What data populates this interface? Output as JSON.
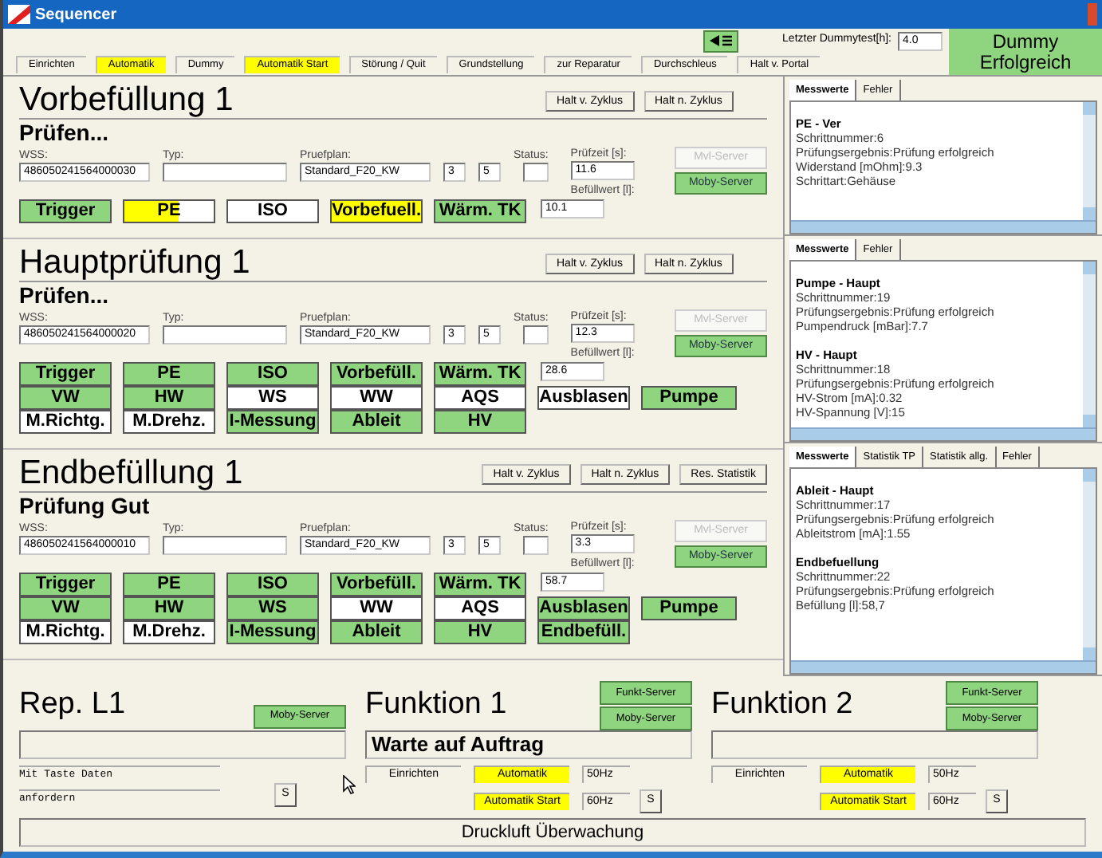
{
  "window": {
    "title": "Sequencer"
  },
  "toolbar": {
    "modes": [
      {
        "label": "Einrichten",
        "selected": false
      },
      {
        "label": "Automatik",
        "selected": true
      },
      {
        "label": "Dummy",
        "selected": false
      },
      {
        "label": "Automatik Start",
        "selected": true
      },
      {
        "label": "Störung / Quit",
        "selected": false
      },
      {
        "label": "Grundstellung",
        "selected": false
      },
      {
        "label": "zur Reparatur",
        "selected": false
      },
      {
        "label": "Durchschleus",
        "selected": false
      },
      {
        "label": "Halt v. Portal",
        "selected": false
      }
    ],
    "dummy_label": "Letzter Dummytest[h]:",
    "dummy_value": "4.0",
    "dummy_status": "Dummy Erfolgreich"
  },
  "stations": [
    {
      "title": "Vorbefüllung 1",
      "status": "Prüfen...",
      "halt_buttons": [
        "Halt v. Zyklus",
        "Halt n. Zyklus"
      ],
      "fields": {
        "wss_label": "WSS:",
        "wss": "486050241564000030",
        "typ_label": "Typ:",
        "pruefplan_label": "Pruefplan:",
        "pruefplan": "Standard_F20_KW",
        "num_1": "3",
        "num_2": "5",
        "status_label": "Status:",
        "pruefzeit_label": "Prüfzeit [s]:",
        "pruefzeit": "11.6",
        "befuellwert_label": "Befüllwert [l]:",
        "befuellwert": "10.1"
      },
      "servers": [
        {
          "label": "Mvl-Server",
          "disabled": true
        },
        {
          "label": "Moby-Server",
          "disabled": false
        }
      ],
      "indicators": [
        [
          {
            "label": "Trigger",
            "color": "#8fd47e"
          },
          {
            "label": "PE",
            "color": "#ffff00",
            "level": 0.6
          },
          {
            "label": "ISO",
            "color": "#ffffff"
          },
          {
            "label": "Vorbefuell.",
            "color": "#ffff00"
          },
          {
            "label": "Wärm. TK",
            "color": "#8fd47e"
          }
        ]
      ]
    },
    {
      "title": "Hauptprüfung 1",
      "status": "Prüfen...",
      "halt_buttons": [
        "Halt v. Zyklus",
        "Halt n. Zyklus"
      ],
      "fields": {
        "wss_label": "WSS:",
        "wss": "486050241564000020",
        "typ_label": "Typ:",
        "pruefplan_label": "Pruefplan:",
        "pruefplan": "Standard_F20_KW",
        "num_1": "3",
        "num_2": "5",
        "status_label": "Status:",
        "pruefzeit_label": "Prüfzeit [s]:",
        "pruefzeit": "12.3",
        "befuellwert_label": "Befüllwert [l]:",
        "befuellwert": "28.6"
      },
      "servers": [
        {
          "label": "Mvl-Server",
          "disabled": true
        },
        {
          "label": "Moby-Server",
          "disabled": false
        }
      ],
      "indicators": [
        [
          {
            "label": "Trigger",
            "color": "#8fd47e"
          },
          {
            "label": "PE",
            "color": "#8fd47e"
          },
          {
            "label": "ISO",
            "color": "#8fd47e"
          },
          {
            "label": "Vorbefüll.",
            "color": "#8fd47e"
          },
          {
            "label": "Wärm. TK",
            "color": "#8fd47e"
          }
        ],
        [
          {
            "label": "VW",
            "color": "#8fd47e"
          },
          {
            "label": "HW",
            "color": "#8fd47e"
          },
          {
            "label": "WS",
            "color": "#ffffff"
          },
          {
            "label": "WW",
            "color": "#ffffff"
          },
          {
            "label": "AQS",
            "color": "#ffffff"
          },
          {
            "label": "Ausblasen",
            "color": "#ffffff"
          },
          {
            "label": "Pumpe",
            "color": "#8fd47e"
          }
        ],
        [
          {
            "label": "M.Richtg.",
            "color": "#ffffff"
          },
          {
            "label": "M.Drehz.",
            "color": "#ffffff"
          },
          {
            "label": "I-Messung",
            "color": "#8fd47e"
          },
          {
            "label": "Ableit",
            "color": "#8fd47e"
          },
          {
            "label": "HV",
            "color": "#8fd47e"
          }
        ]
      ]
    },
    {
      "title": "Endbefüllung 1",
      "status": "Prüfung Gut",
      "halt_buttons": [
        "Halt v. Zyklus",
        "Halt n. Zyklus",
        "Res. Statistik"
      ],
      "fields": {
        "wss_label": "WSS:",
        "wss": "486050241564000010",
        "typ_label": "Typ:",
        "pruefplan_label": "Pruefplan:",
        "pruefplan": "Standard_F20_KW",
        "num_1": "3",
        "num_2": "5",
        "status_label": "Status:",
        "pruefzeit_label": "Prüfzeit [s]:",
        "pruefzeit": "3.3",
        "befuellwert_label": "Befüllwert [l]:",
        "befuellwert": "58.7"
      },
      "servers": [
        {
          "label": "Mvl-Server",
          "disabled": true
        },
        {
          "label": "Moby-Server",
          "disabled": false
        }
      ],
      "indicators": [
        [
          {
            "label": "Trigger",
            "color": "#8fd47e"
          },
          {
            "label": "PE",
            "color": "#8fd47e"
          },
          {
            "label": "ISO",
            "color": "#8fd47e"
          },
          {
            "label": "Vorbefüll.",
            "color": "#8fd47e"
          },
          {
            "label": "Wärm. TK",
            "color": "#8fd47e"
          }
        ],
        [
          {
            "label": "VW",
            "color": "#8fd47e"
          },
          {
            "label": "HW",
            "color": "#8fd47e"
          },
          {
            "label": "WS",
            "color": "#8fd47e"
          },
          {
            "label": "WW",
            "color": "#ffffff"
          },
          {
            "label": "AQS",
            "color": "#ffffff"
          },
          {
            "label": "Ausblasen",
            "color": "#8fd47e"
          },
          {
            "label": "Pumpe",
            "color": "#8fd47e"
          }
        ],
        [
          {
            "label": "M.Richtg.",
            "color": "#ffffff"
          },
          {
            "label": "M.Drehz.",
            "color": "#ffffff"
          },
          {
            "label": "I-Messung",
            "color": "#8fd47e"
          },
          {
            "label": "Ableit",
            "color": "#8fd47e"
          },
          {
            "label": "HV",
            "color": "#8fd47e"
          },
          {
            "label": "Endbefüll.",
            "color": "#8fd47e"
          }
        ]
      ]
    }
  ],
  "panels": [
    {
      "tabs": [
        {
          "label": "Messwerte",
          "selected": true
        },
        {
          "label": "Fehler",
          "selected": false
        }
      ],
      "entries": [
        {
          "title": "PE - Ver",
          "lines": [
            "Schrittnummer:6",
            "Prüfungsergebnis:Prüfung erfolgreich",
            "Widerstand [mOhm]:9.3",
            "Schrittart:Gehäuse"
          ]
        }
      ]
    },
    {
      "tabs": [
        {
          "label": "Messwerte",
          "selected": true
        },
        {
          "label": "Fehler",
          "selected": false
        }
      ],
      "entries": [
        {
          "title": "Pumpe - Haupt",
          "lines": [
            "Schrittnummer:19",
            "Prüfungsergebnis:Prüfung erfolgreich",
            "Pumpendruck [mBar]:7.7"
          ]
        },
        {
          "title": "HV - Haupt",
          "lines": [
            "Schrittnummer:18",
            "Prüfungsergebnis:Prüfung erfolgreich",
            "HV-Strom [mA]:0.32",
            "HV-Spannung [V]:15"
          ]
        }
      ]
    },
    {
      "tabs": [
        {
          "label": "Messwerte",
          "selected": true
        },
        {
          "label": "Statistik TP",
          "selected": false
        },
        {
          "label": "Statistik allg.",
          "selected": false
        },
        {
          "label": "Fehler",
          "selected": false
        }
      ],
      "entries": [
        {
          "title": "Ableit - Haupt",
          "lines": [
            "Schrittnummer:17",
            "Prüfungsergebnis:Prüfung erfolgreich",
            "Ableitstrom [mA]:1.55"
          ]
        },
        {
          "title": "Endbefuellung",
          "lines": [
            "Schrittnummer:22",
            "Prüfungsergebnis:Prüfung erfolgreich",
            "Befüllung [l]:58,7"
          ]
        }
      ]
    }
  ],
  "repair": {
    "title": "Rep. L1",
    "server": "Moby-Server",
    "message_lines": [
      "Mit Taste Daten",
      "anfordern"
    ],
    "s_button": "S"
  },
  "functions": [
    {
      "title": "Funktion 1",
      "servers": [
        "Funkt-Server",
        "Moby-Server"
      ],
      "status": "Warte auf Auftrag",
      "modes": [
        {
          "label": "Einrichten",
          "selected": false
        },
        {
          "label": "Automatik",
          "selected": true
        },
        {
          "label": "Automatik Start",
          "selected": true
        }
      ],
      "freqs": [
        "50Hz",
        "60Hz"
      ],
      "s_button": "S"
    },
    {
      "title": "Funktion 2",
      "servers": [
        "Funkt-Server",
        "Moby-Server"
      ],
      "modes": [
        {
          "label": "Einrichten",
          "selected": false
        },
        {
          "label": "Automatik",
          "selected": true
        },
        {
          "label": "Automatik Start",
          "selected": true
        }
      ],
      "freqs": [
        "50Hz",
        "60Hz"
      ],
      "s_button": "S"
    }
  ],
  "footer": "Druckluft Überwachung"
}
